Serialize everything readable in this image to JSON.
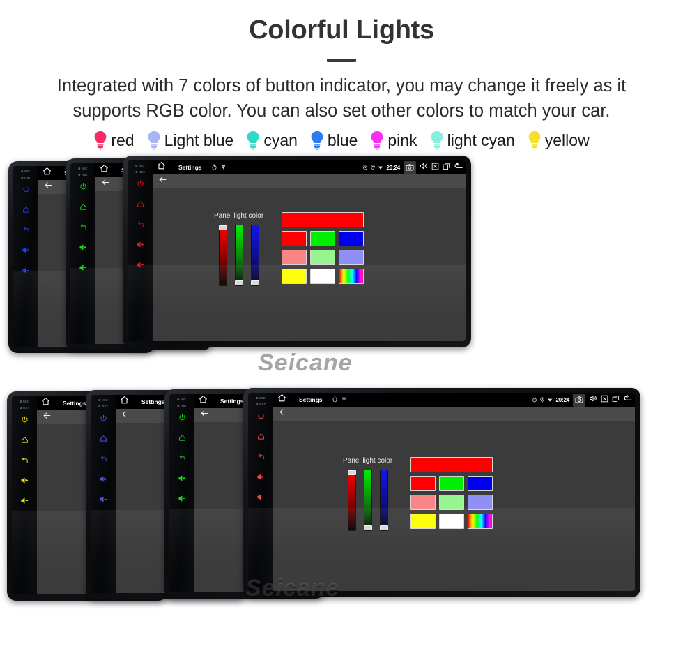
{
  "header": {
    "title": "Colorful Lights",
    "subtitle": "Integrated with 7 colors of button indicator, you may change it freely as it supports RGB color. You can also set other colors to match your car."
  },
  "legend": {
    "items": [
      {
        "label": "red",
        "icon": "bulb-icon",
        "color": "#f72a64"
      },
      {
        "label": "Light blue",
        "icon": "bulb-icon",
        "color": "#a8b4f5"
      },
      {
        "label": "cyan",
        "icon": "bulb-icon",
        "color": "#2fd9c8"
      },
      {
        "label": "blue",
        "icon": "bulb-icon",
        "color": "#2d7bf0"
      },
      {
        "label": "pink",
        "icon": "bulb-icon",
        "color": "#f62ef6"
      },
      {
        "label": "light cyan",
        "icon": "bulb-icon",
        "color": "#86f0de"
      },
      {
        "label": "yellow",
        "icon": "bulb-icon",
        "color": "#f7e02a"
      }
    ]
  },
  "device_ui": {
    "statusbar": {
      "home_icon": "home-icon",
      "title": "Settings",
      "timer_icon": "stopwatch-icon",
      "usb_icon": "usb-icon",
      "alarm_icon": "alarm-icon",
      "location_icon": "location-pin-icon",
      "wifi_icon": "wifi-icon",
      "clock": "20:24",
      "camera_icon": "camera-icon",
      "volume_icon": "volume-icon",
      "close_icon": "close-box-icon",
      "recents_icon": "recent-apps-icon",
      "back_icon": "back-arrow-icon"
    },
    "subbar": {
      "back_icon": "back-arrow-icon"
    },
    "picker": {
      "label": "Panel light color",
      "sliders": [
        {
          "name": "red-slider",
          "value": 100
        },
        {
          "name": "green-slider",
          "value": 0
        },
        {
          "name": "blue-slider",
          "value": 0
        }
      ],
      "preview_color": "#ff0000",
      "swatch_rows": [
        [
          "#ff0000",
          "#00ee00",
          "#0000ee"
        ],
        [
          "#fa8585",
          "#96f58f",
          "#8f8ff5"
        ],
        [
          "#ffff00",
          "#ffffff",
          "rainbow"
        ]
      ]
    },
    "rail": {
      "mic_label": "MIC",
      "rst_label": "RST",
      "buttons": [
        "power-icon",
        "home-icon",
        "back-icon",
        "volume-up-icon",
        "volume-down-icon"
      ]
    },
    "watermark": "Seicane"
  },
  "groups": {
    "top": {
      "name": "top-device-stack",
      "devices": [
        {
          "name": "device-blue",
          "button_color": "#1e3df0"
        },
        {
          "name": "device-green",
          "button_color": "#18d818"
        },
        {
          "name": "device-red",
          "button_color": "#e01212"
        }
      ]
    },
    "bottom": {
      "name": "bottom-device-stack",
      "devices": [
        {
          "name": "device-yellow",
          "button_color": "#e8dd18"
        },
        {
          "name": "device-purple",
          "button_color": "#5a52d8"
        },
        {
          "name": "device-green",
          "button_color": "#18d818"
        },
        {
          "name": "device-red",
          "button_color": "#e84a4a"
        }
      ]
    }
  }
}
